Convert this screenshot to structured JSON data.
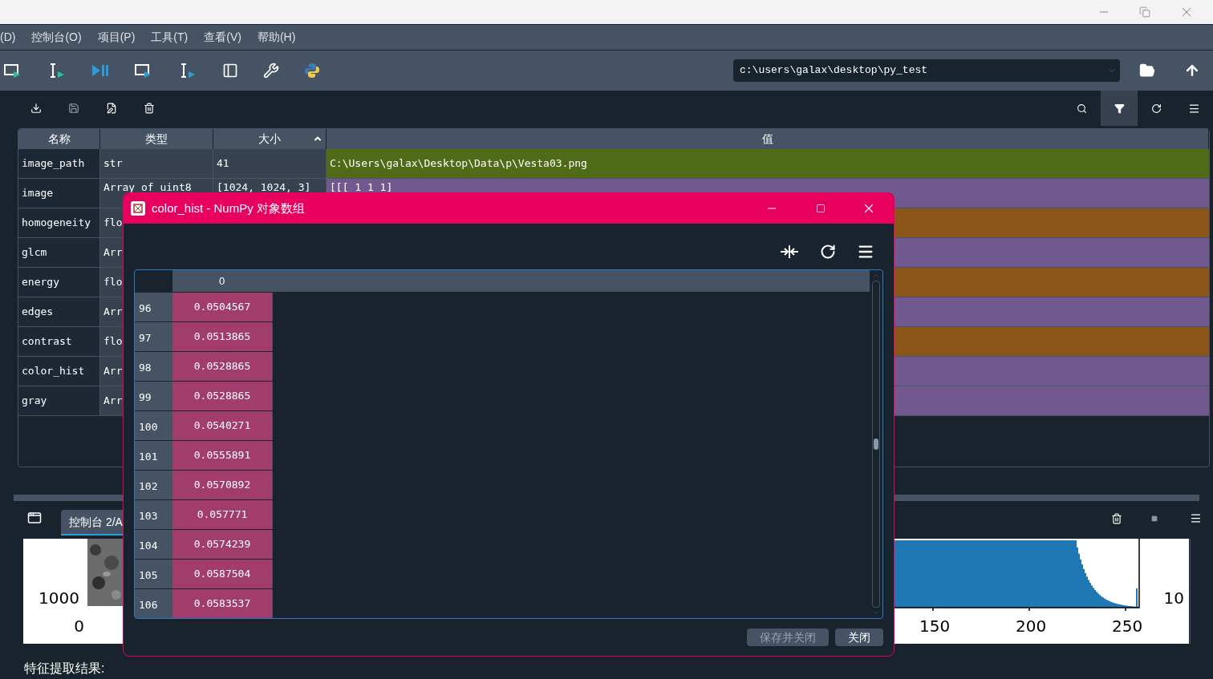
{
  "menu": [
    "(D)",
    "控制台(O)",
    "项目(P)",
    "工具(T)",
    "查看(V)",
    "帮助(H)"
  ],
  "path": "c:\\users\\galax\\desktop\\py_test",
  "variable_explorer": {
    "filter_on": true,
    "columns": [
      {
        "label": "名称",
        "sorted": false
      },
      {
        "label": "类型",
        "sorted": false
      },
      {
        "label": "大小",
        "sorted": true
      },
      {
        "label": "值",
        "sorted": false
      }
    ],
    "rows": [
      {
        "name": "image_path",
        "type": "str",
        "size": "41",
        "value": "C:\\Users\\galax\\Desktop\\Data\\p\\Vesta03.png",
        "color": "#4f6b17"
      },
      {
        "name": "image",
        "type": "Array of uint8",
        "size": "[1024, 1024, 3]",
        "value": "[[[  1   1   1]",
        "color": "#71588f"
      },
      {
        "name": "homogeneity",
        "type": "flo",
        "color": "#8b5519"
      },
      {
        "name": "glcm",
        "type": "Arr",
        "color": "#71588f"
      },
      {
        "name": "energy",
        "type": "flo",
        "color": "#8b5519"
      },
      {
        "name": "edges",
        "type": "Arr",
        "color": "#71588f"
      },
      {
        "name": "contrast",
        "type": "flo",
        "color": "#8b5519"
      },
      {
        "name": "color_hist",
        "type": "Arr",
        "color": "#71588f"
      },
      {
        "name": "gray",
        "type": "Arr",
        "color": "#71588f"
      }
    ]
  },
  "dialog": {
    "title": "color_hist - NumPy 对象数组",
    "column": "0",
    "rows": [
      {
        "index": "96",
        "value": "0.0504567"
      },
      {
        "index": "97",
        "value": "0.0513865"
      },
      {
        "index": "98",
        "value": "0.0528865"
      },
      {
        "index": "99",
        "value": "0.0528865"
      },
      {
        "index": "100",
        "value": "0.0540271"
      },
      {
        "index": "101",
        "value": "0.0555891"
      },
      {
        "index": "102",
        "value": "0.0570892"
      },
      {
        "index": "103",
        "value": "0.057771"
      },
      {
        "index": "104",
        "value": "0.0574239"
      },
      {
        "index": "105",
        "value": "0.0587504"
      },
      {
        "index": "106",
        "value": "0.0583537"
      }
    ],
    "buttons": [
      {
        "label": "保存并关闭",
        "disabled": true
      },
      {
        "label": "关闭",
        "disabled": false
      }
    ]
  },
  "console": {
    "tab": "控制台 2/A",
    "left_ticks": [
      "1000",
      "0"
    ],
    "bottom_ticks": [
      "150",
      "200",
      "250"
    ],
    "right_label": "10",
    "output": "特征提取结果:"
  }
}
